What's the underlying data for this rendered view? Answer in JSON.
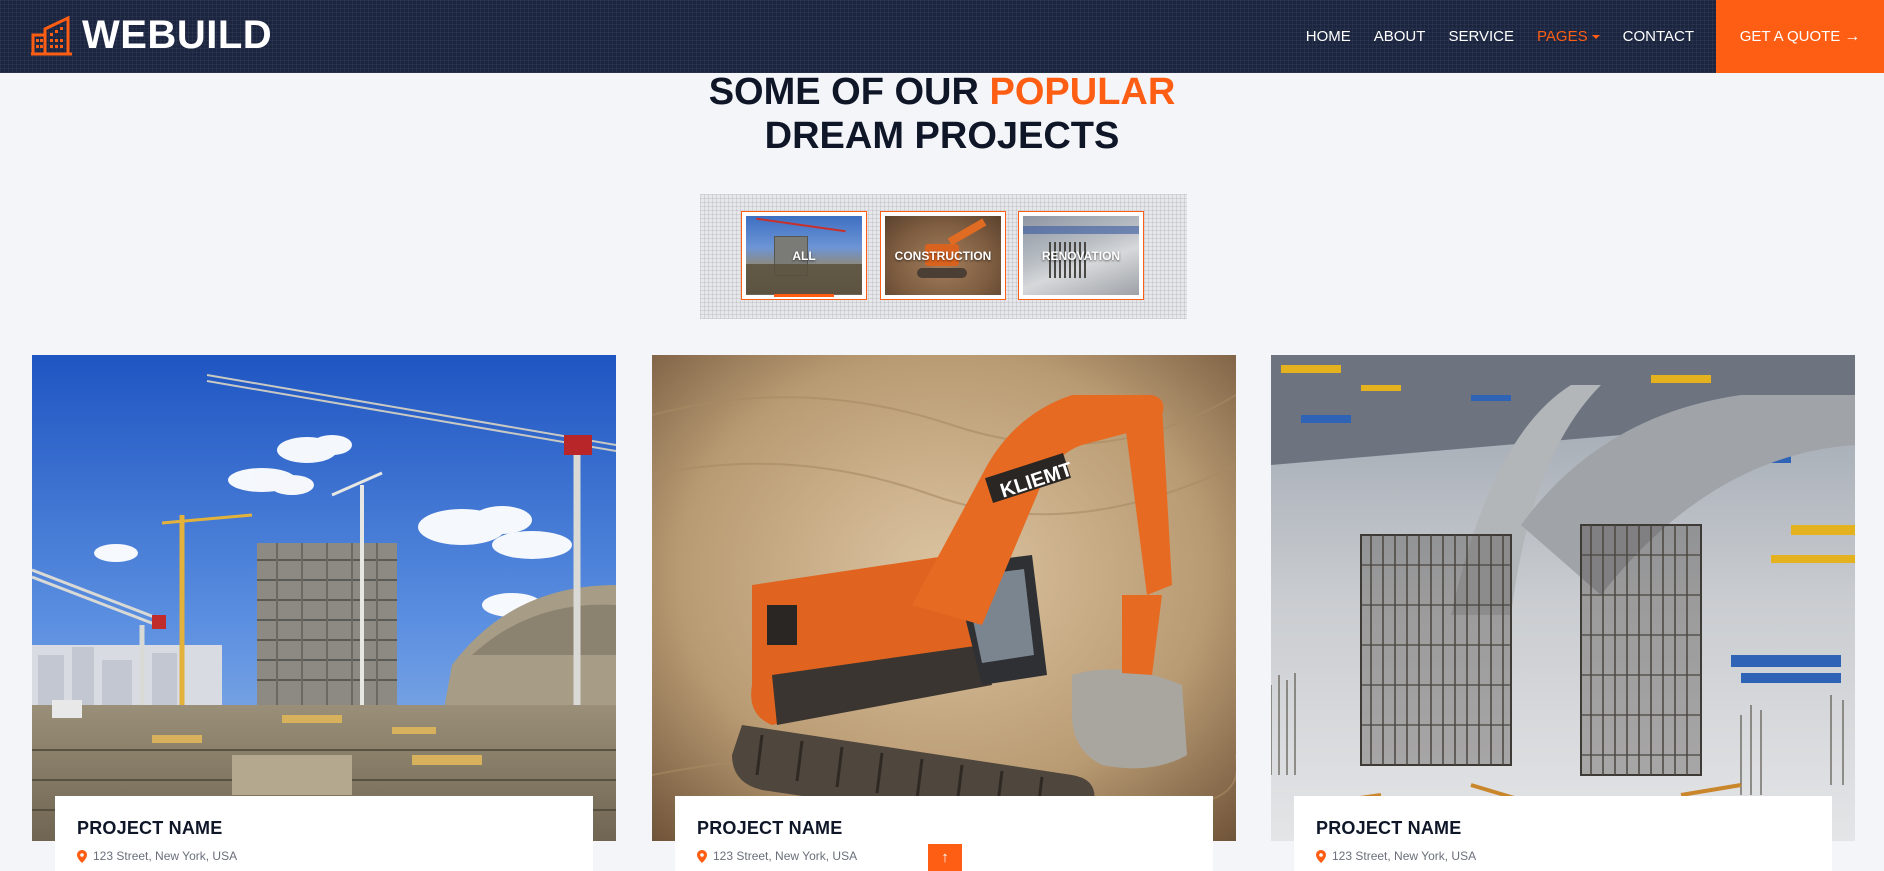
{
  "brand": {
    "name": "WEBUILD",
    "icon": "building-icon"
  },
  "nav": {
    "items": [
      {
        "label": "HOME"
      },
      {
        "label": "ABOUT"
      },
      {
        "label": "SERVICE"
      },
      {
        "label": "PAGES",
        "active": true,
        "dropdown": true
      },
      {
        "label": "CONTACT"
      }
    ],
    "cta": {
      "label": "GET A QUOTE",
      "icon": "arrow-right-icon"
    }
  },
  "section": {
    "title_part1": "SOME OF OUR ",
    "title_accent": "POPULAR",
    "title_line2": "DREAM PROJECTS"
  },
  "filters": [
    {
      "label": "ALL",
      "selected": true
    },
    {
      "label": "CONSTRUCTION",
      "selected": false
    },
    {
      "label": "RENOVATION",
      "selected": false
    }
  ],
  "projects": [
    {
      "name": "PROJECT NAME",
      "address": "123 Street, New York, USA",
      "image": "construction-site-cranes"
    },
    {
      "name": "PROJECT NAME",
      "address": "123 Street, New York, USA",
      "image": "orange-excavator"
    },
    {
      "name": "PROJECT NAME",
      "address": "123 Street, New York, USA",
      "image": "rebar-foundation"
    }
  ],
  "excavator_brand": "KLIEMT",
  "colors": {
    "accent": "#fe5d14",
    "navy": "#1b2540",
    "heading": "#0e1628",
    "background": "#f4f5f8"
  },
  "back_to_top": {
    "icon": "arrow-up-icon"
  }
}
